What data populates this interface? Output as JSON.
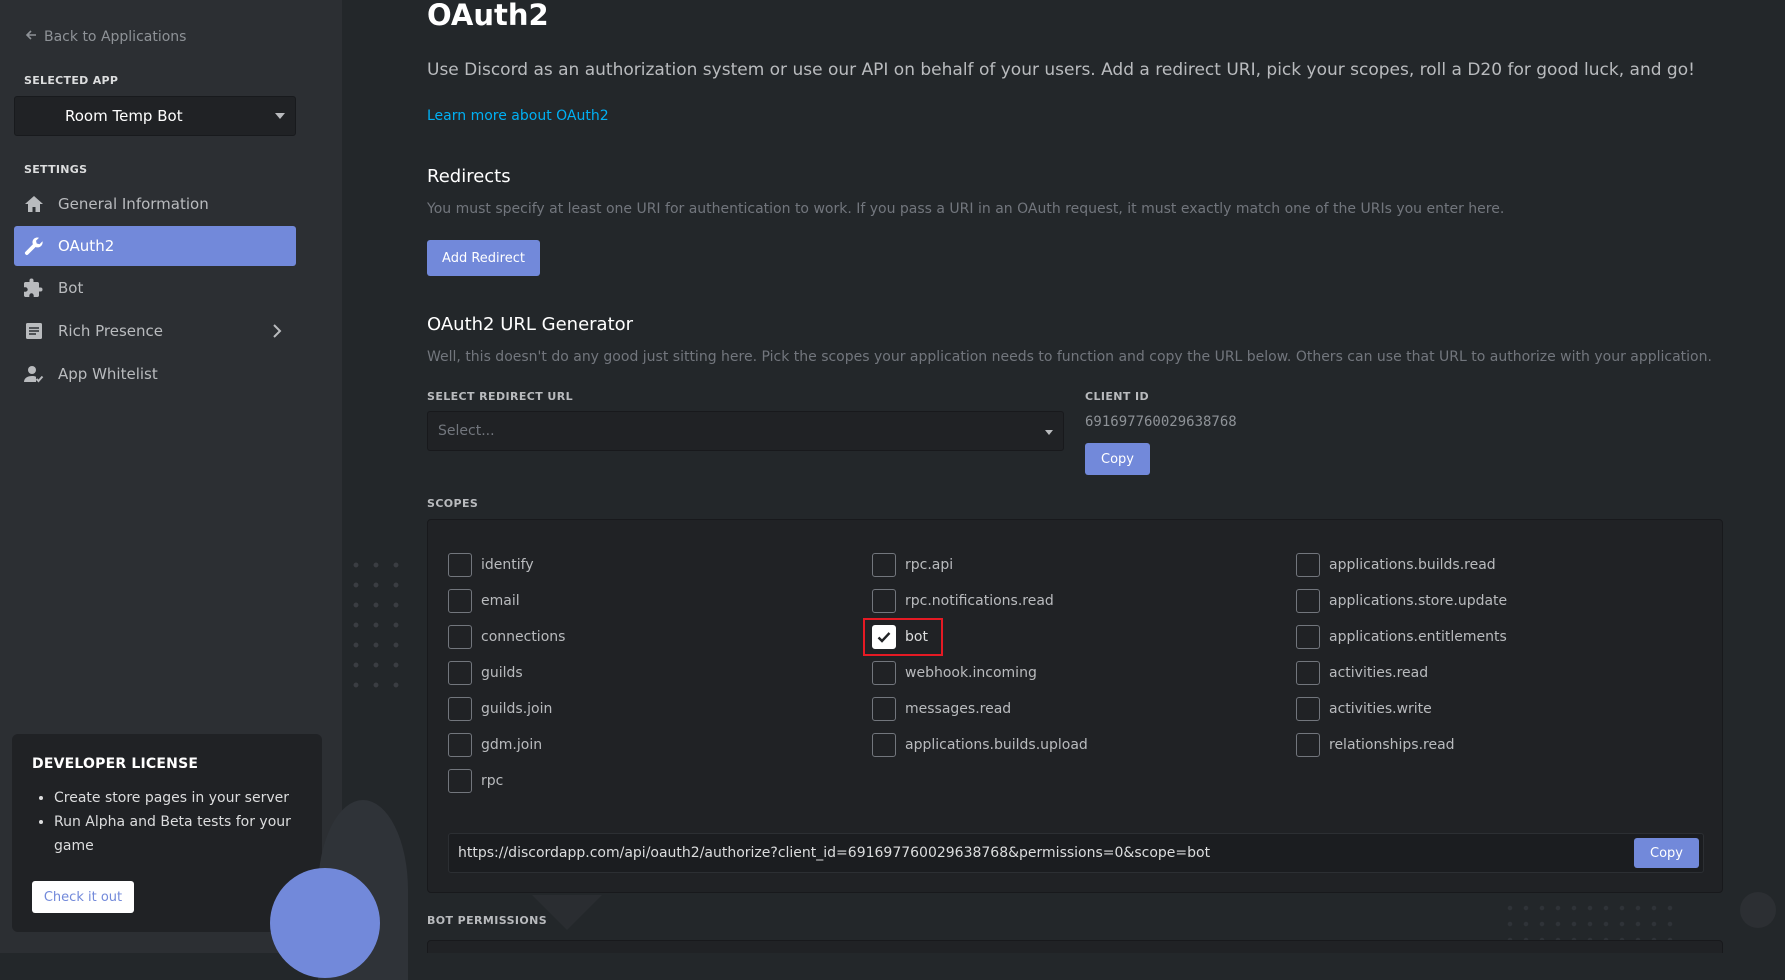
{
  "sidebar": {
    "back_label": "Back to Applications",
    "selected_app_label": "SELECTED APP",
    "selected_app": "Room Temp Bot",
    "settings_label": "SETTINGS",
    "items": [
      {
        "label": "General Information",
        "icon": "home-icon",
        "active": false
      },
      {
        "label": "OAuth2",
        "icon": "wrench-icon",
        "active": true
      },
      {
        "label": "Bot",
        "icon": "puzzle-icon",
        "active": false
      },
      {
        "label": "Rich Presence",
        "icon": "document-icon",
        "active": false,
        "expandable": true
      },
      {
        "label": "App Whitelist",
        "icon": "user-check-icon",
        "active": false
      }
    ],
    "dev_license": {
      "title": "DEVELOPER LICENSE",
      "bullets": [
        "Create store pages in your server",
        "Run Alpha and Beta tests for your game"
      ],
      "button": "Check it out"
    }
  },
  "main": {
    "title": "OAuth2",
    "intro": "Use Discord as an authorization system or use our API on behalf of your users. Add a redirect URI, pick your scopes, roll a D20 for good luck, and go!",
    "learn_more": "Learn more about OAuth2",
    "redirects": {
      "title": "Redirects",
      "description": "You must specify at least one URI for authentication to work. If you pass a URI in an OAuth request, it must exactly match one of the URIs you enter here.",
      "add_button": "Add Redirect"
    },
    "generator": {
      "title": "OAuth2 URL Generator",
      "description": "Well, this doesn't do any good just sitting here. Pick the scopes your application needs to function and copy the URL below. Others can use that URL to authorize with your application.",
      "redirect_label": "SELECT REDIRECT URL",
      "redirect_placeholder": "Select...",
      "client_id_label": "CLIENT ID",
      "client_id": "691697760029638768",
      "copy_label": "Copy"
    },
    "scopes": {
      "label": "SCOPES",
      "columns": [
        [
          {
            "name": "identify",
            "checked": false
          },
          {
            "name": "email",
            "checked": false
          },
          {
            "name": "connections",
            "checked": false
          },
          {
            "name": "guilds",
            "checked": false
          },
          {
            "name": "guilds.join",
            "checked": false
          },
          {
            "name": "gdm.join",
            "checked": false
          },
          {
            "name": "rpc",
            "checked": false
          }
        ],
        [
          {
            "name": "rpc.api",
            "checked": false
          },
          {
            "name": "rpc.notifications.read",
            "checked": false
          },
          {
            "name": "bot",
            "checked": true
          },
          {
            "name": "webhook.incoming",
            "checked": false
          },
          {
            "name": "messages.read",
            "checked": false
          },
          {
            "name": "applications.builds.upload",
            "checked": false
          }
        ],
        [
          {
            "name": "applications.builds.read",
            "checked": false
          },
          {
            "name": "applications.store.update",
            "checked": false
          },
          {
            "name": "applications.entitlements",
            "checked": false
          },
          {
            "name": "activities.read",
            "checked": false
          },
          {
            "name": "activities.write",
            "checked": false
          },
          {
            "name": "relationships.read",
            "checked": false
          }
        ]
      ],
      "generated_url": "https://discordapp.com/api/oauth2/authorize?client_id=691697760029638768&permissions=0&scope=bot",
      "copy_label": "Copy"
    },
    "bot_permissions_label": "BOT PERMISSIONS"
  },
  "colors": {
    "blurple": "#7289da",
    "sidebar_bg": "#2c2f33",
    "main_bg": "#23272a",
    "input_bg": "#202225",
    "highlight": "#e51a24",
    "link": "#00b0f4"
  }
}
